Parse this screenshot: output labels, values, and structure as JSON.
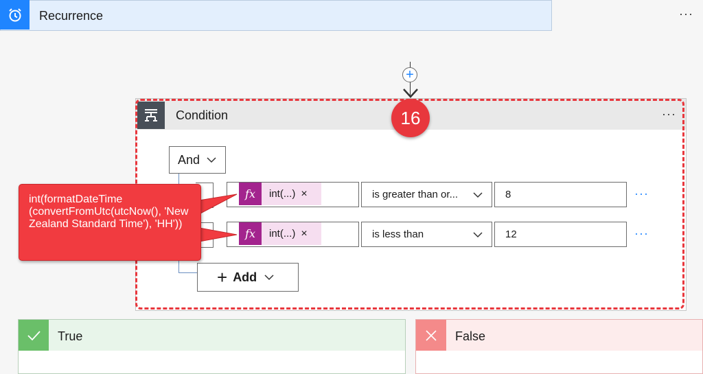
{
  "recurrence": {
    "title": "Recurrence",
    "icon": "alarm-clock-icon",
    "more": "···"
  },
  "condition": {
    "title": "Condition",
    "icon": "condition-icon",
    "more": "···",
    "group_operator": "And",
    "rows": [
      {
        "operand_token": "int(...)",
        "operand_remove": "×",
        "operator": "is greater than or...",
        "value": "8",
        "more": "···"
      },
      {
        "operand_token": "int(...)",
        "operand_remove": "×",
        "operator": "is less than",
        "value": "12",
        "more": "···"
      }
    ],
    "add_label": "Add",
    "fx_label": "fx"
  },
  "badge": {
    "number": "16",
    "color": "#e8373d"
  },
  "callout": {
    "text": "int(formatDateTime (convertFromUtc(utcNow(), 'New Zealand Standard Time'), 'HH'))"
  },
  "branches": {
    "true_label": "True",
    "false_label": "False"
  },
  "colors": {
    "accent": "#1f85ff",
    "fx_token": "#a3248e",
    "highlight": "#e8373d",
    "true": "#6abf69",
    "false": "#f48a8a"
  }
}
